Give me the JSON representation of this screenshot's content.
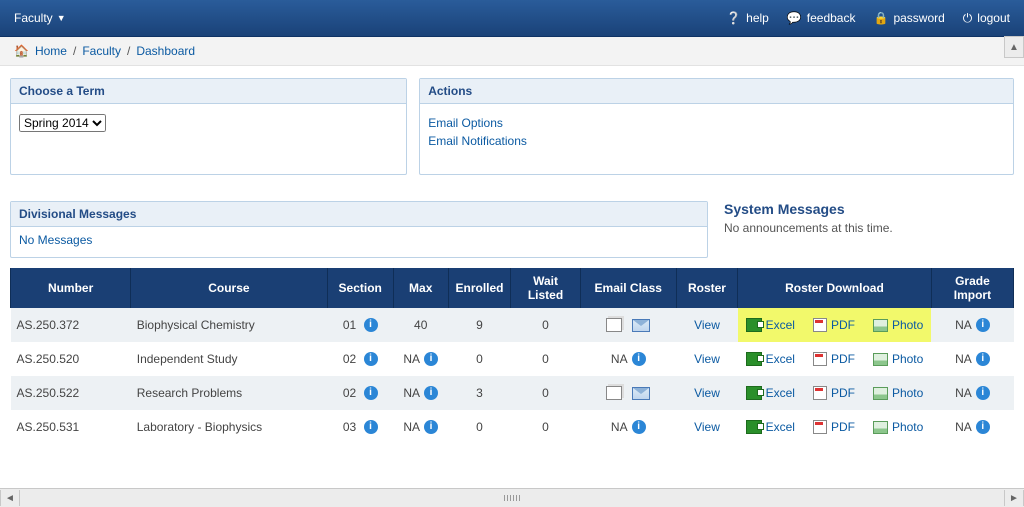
{
  "topbar": {
    "brand": "Faculty",
    "links": {
      "help": "help",
      "feedback": "feedback",
      "password": "password",
      "logout": "logout"
    }
  },
  "crumb": {
    "home": "Home",
    "faculty": "Faculty",
    "dashboard": "Dashboard"
  },
  "termPanel": {
    "title": "Choose a Term",
    "value": "Spring 2014"
  },
  "actionsPanel": {
    "title": "Actions",
    "opt1": "Email Options",
    "opt2": "Email Notifications"
  },
  "divPanel": {
    "title": "Divisional Messages",
    "body": "No Messages"
  },
  "sys": {
    "title": "System Messages",
    "body": "No announcements at this time."
  },
  "thead": {
    "number": "Number",
    "course": "Course",
    "section": "Section",
    "max": "Max",
    "enrolled": "Enrolled",
    "wait": "Wait Listed",
    "email": "Email Class",
    "roster": "Roster",
    "rdl": "Roster Download",
    "grade": "Grade Import"
  },
  "labels": {
    "view": "View",
    "excel": "Excel",
    "pdf": "PDF",
    "photo": "Photo",
    "na": "NA"
  },
  "rows": [
    {
      "num": "AS.250.372",
      "course": "Biophysical Chemistry",
      "section": "01",
      "max": "40",
      "enrolled": "9",
      "wait": "0",
      "emailIcons": true,
      "highlight": true
    },
    {
      "num": "AS.250.520",
      "course": "Independent Study",
      "section": "02",
      "max": "NA",
      "enrolled": "0",
      "wait": "0",
      "emailIcons": false,
      "highlight": false
    },
    {
      "num": "AS.250.522",
      "course": "Research Problems",
      "section": "02",
      "max": "NA",
      "enrolled": "3",
      "wait": "0",
      "emailIcons": true,
      "highlight": false
    },
    {
      "num": "AS.250.531",
      "course": "Laboratory - Biophysics",
      "section": "03",
      "max": "NA",
      "enrolled": "0",
      "wait": "0",
      "emailIcons": false,
      "highlight": false
    }
  ]
}
